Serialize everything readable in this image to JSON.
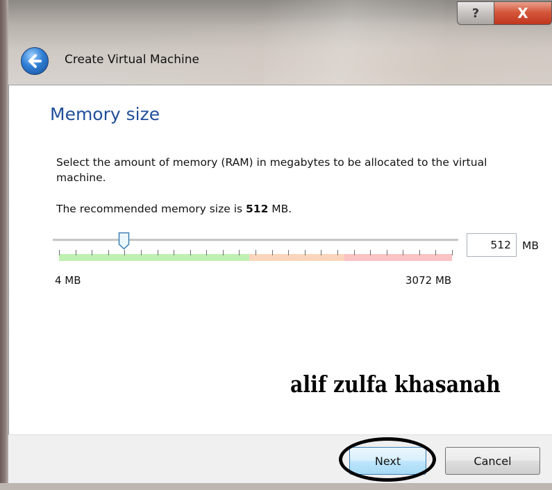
{
  "window": {
    "title": "Create Virtual Machine",
    "help_label": "?",
    "close_label": "X"
  },
  "page": {
    "title": "Memory size",
    "description": "Select the amount of memory (RAM) in megabytes to be allocated to the virtual machine.",
    "recommend_prefix": "The recommended memory size is ",
    "recommend_value": "512",
    "recommend_suffix": " MB."
  },
  "slider": {
    "min_label": "4 MB",
    "max_label": "3072 MB",
    "min_value": 4,
    "max_value": 3072,
    "current_value": 512,
    "colors": {
      "safe": "#bff0b3",
      "warning": "#fcd6bc",
      "danger": "#fbc3c3"
    }
  },
  "memory_input": {
    "value": "512",
    "unit": "MB"
  },
  "watermark": {
    "text": "alif zulfa khasanah"
  },
  "buttons": {
    "next_label": "Next",
    "cancel_label": "Cancel"
  },
  "colors": {
    "title_blue": "#1f4e9a",
    "close_red": "#c0351d"
  }
}
